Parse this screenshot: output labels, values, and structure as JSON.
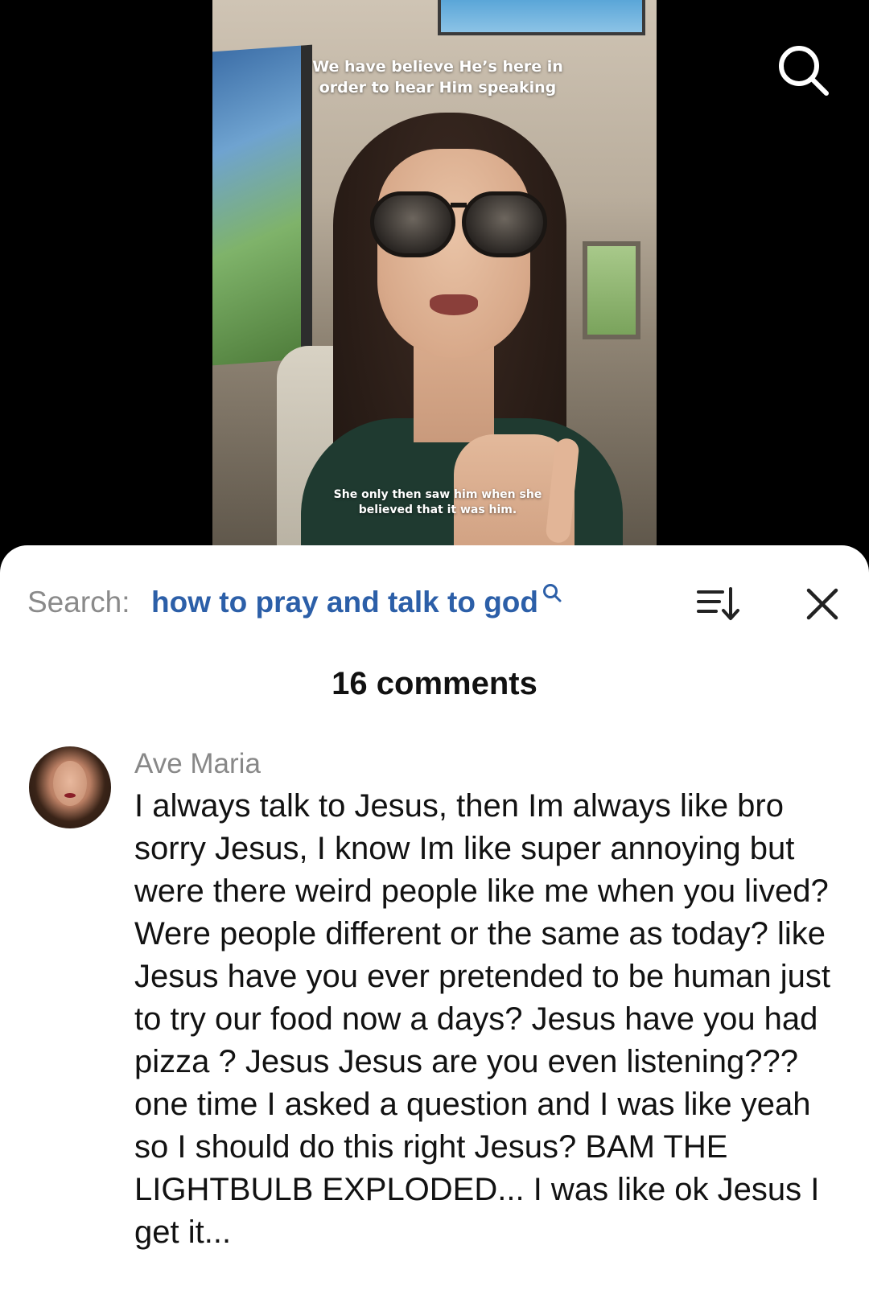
{
  "video": {
    "caption_top": "We have believe He’s here in order to hear Him speaking",
    "caption_bottom": "She only then saw him when she believed that it was him.",
    "search_icon": "search-icon"
  },
  "comments_sheet": {
    "search_label": "Search:",
    "search_query": "how to pray and talk to god",
    "query_icon": "search-icon",
    "sort_icon": "sort-icon",
    "close_icon": "close-icon",
    "comment_count": "16 comments",
    "query_color": "#2c5fa8",
    "comments": [
      {
        "author": "Ave Maria",
        "avatar": "avatar",
        "text": "I always talk to Jesus, then Im always like bro sorry Jesus, I know Im like super annoying but were there weird people like me when you lived? Were people different or the same as today? like Jesus have you ever pretended to be human just to try our food now a days? Jesus have you had pizza ? Jesus Jesus are you even listening??? one time I asked a question and I was like yeah so I should do this right Jesus? BAM THE LIGHTBULB EXPLODED... I was like ok Jesus I get it..."
      }
    ]
  }
}
